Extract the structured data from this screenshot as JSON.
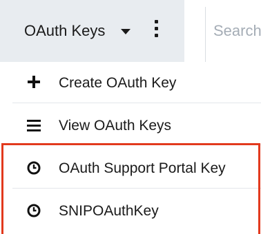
{
  "header": {
    "module_label": "OAuth Keys",
    "search_placeholder": "Search"
  },
  "menu": {
    "items": [
      {
        "label": "Create OAuth Key",
        "icon": "plus-icon"
      },
      {
        "label": "View OAuth Keys",
        "icon": "list-icon"
      },
      {
        "label": "OAuth Support Portal Key",
        "icon": "clock-icon"
      },
      {
        "label": "SNIPOAuthKey",
        "icon": "clock-icon"
      }
    ]
  },
  "colors": {
    "tab_background": "#e8ecf0",
    "highlight_border": "#e2391d",
    "text": "#1a1a1a",
    "search_placeholder": "#a5adb6"
  }
}
